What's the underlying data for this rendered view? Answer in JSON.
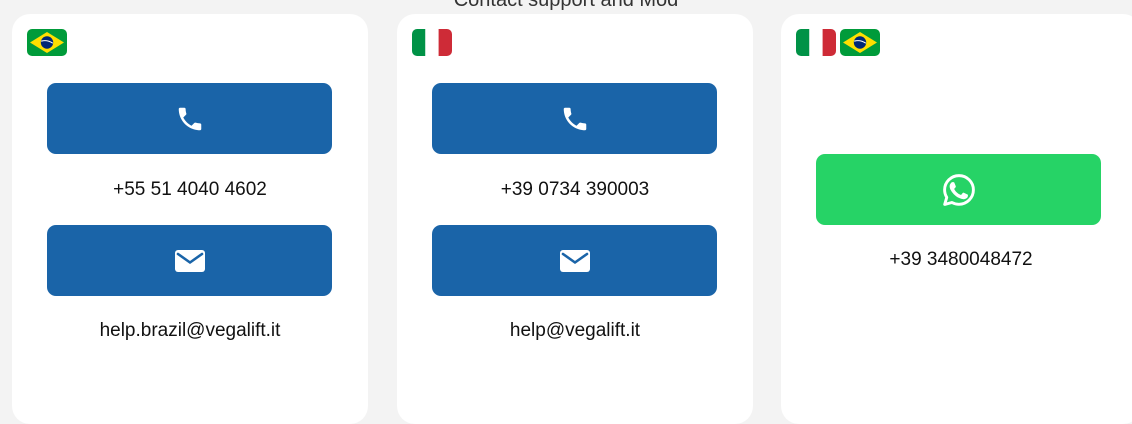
{
  "header": {
    "text": "Contact support and Mod"
  },
  "colors": {
    "primary_blue": "#1a64a8",
    "whatsapp_green": "#26d366",
    "card_background": "#ffffff",
    "page_background": "#f3f3f3"
  },
  "cards": [
    {
      "flags": [
        "brazil-flag-icon"
      ],
      "phone_button_icon": "phone-icon",
      "phone": "+55 51 4040 4602",
      "email_button_icon": "envelope-icon",
      "email": "help.brazil@vegalift.it"
    },
    {
      "flags": [
        "italy-flag-icon"
      ],
      "phone_button_icon": "phone-icon",
      "phone": "+39 0734 390003",
      "email_button_icon": "envelope-icon",
      "email": "help@vegalift.it"
    },
    {
      "flags": [
        "italy-flag-icon",
        "brazil-flag-icon"
      ],
      "whatsapp_button_icon": "whatsapp-icon",
      "whatsapp": "+39 3480048472"
    }
  ]
}
